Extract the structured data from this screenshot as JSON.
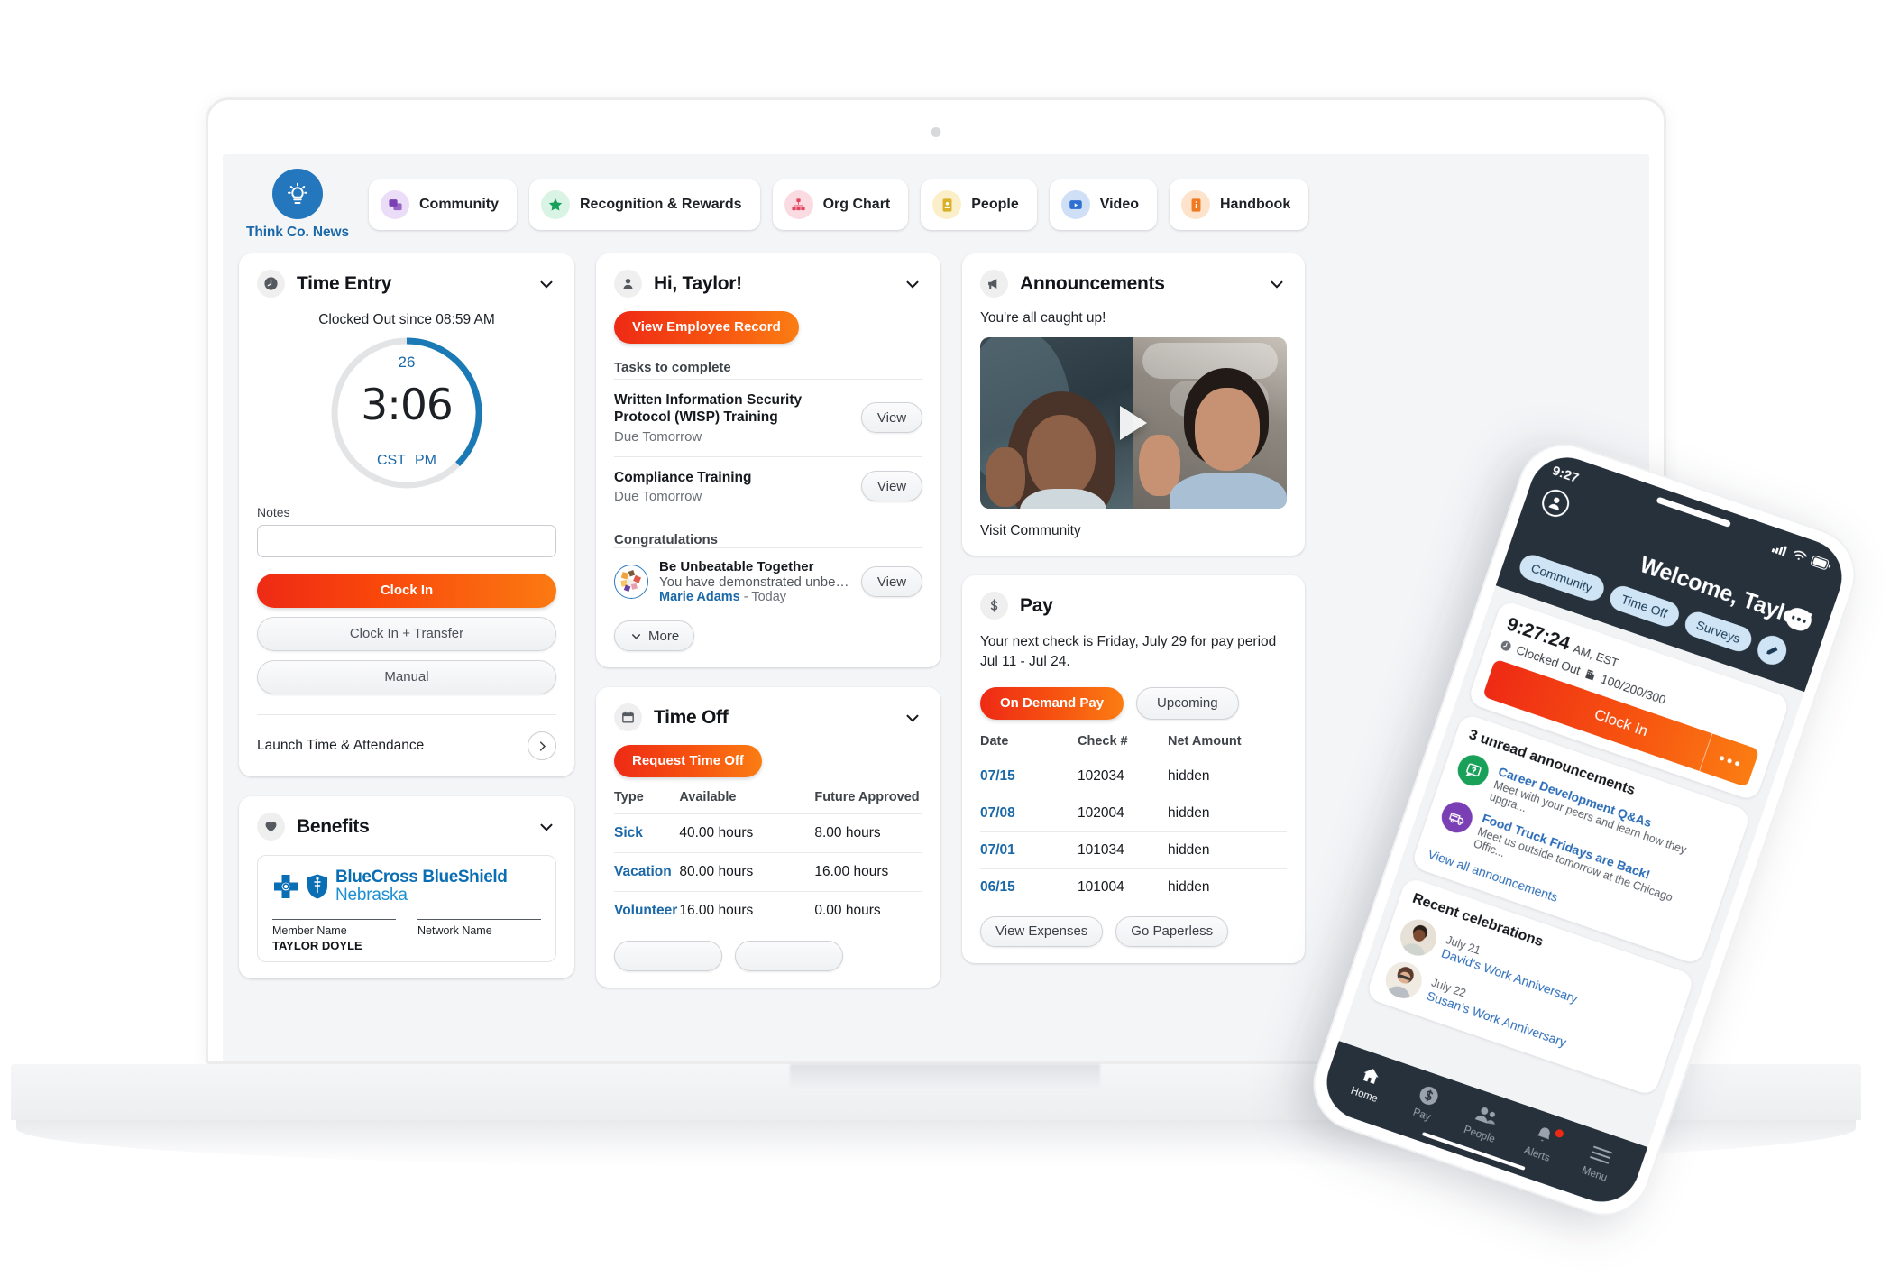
{
  "brand": {
    "label": "Think Co. News",
    "icon": "lightbulb-icon",
    "color": "#2477bd"
  },
  "topnav": {
    "items": [
      {
        "label": "Community",
        "icon": "chat-bubbles-icon",
        "bg": "#ebdcf7",
        "fg": "#7b3fb5"
      },
      {
        "label": "Recognition & Rewards",
        "icon": "star-icon",
        "bg": "#d9f3e4",
        "fg": "#17a05c"
      },
      {
        "label": "Org Chart",
        "icon": "org-chart-icon",
        "bg": "#fbdbe2",
        "fg": "#e3455f"
      },
      {
        "label": "People",
        "icon": "id-card-icon",
        "bg": "#fbefc9",
        "fg": "#d9b128"
      },
      {
        "label": "Video",
        "icon": "video-play-icon",
        "bg": "#cfdff6",
        "fg": "#2f6fd0"
      },
      {
        "label": "Handbook",
        "icon": "handbook-icon",
        "bg": "#fde2cc",
        "fg": "#f07a22"
      }
    ]
  },
  "time_entry": {
    "title": "Time Entry",
    "icon": "clock-icon",
    "status": "Clocked Out since 08:59 AM",
    "dial": {
      "day": "26",
      "time": "3:06",
      "timezone": "CST",
      "meridiem": "PM",
      "arc_percent": 45,
      "arc_color": "#1b7ab5",
      "track_color": "#e3e4e6"
    },
    "notes_label": "Notes",
    "notes_value": "",
    "notes_placeholder": "",
    "clock_in_label": "Clock In",
    "clock_in_transfer_label": "Clock In + Transfer",
    "manual_label": "Manual",
    "launch_label": "Launch Time & Attendance"
  },
  "benefits": {
    "title": "Benefits",
    "icon": "heart-icon",
    "carrier_line1_a": "BlueCross",
    "carrier_line1_b": "BlueShield",
    "carrier_line2": "Nebraska",
    "fields": [
      {
        "key": "Member Name",
        "value": "TAYLOR DOYLE"
      },
      {
        "key": "Network Name",
        "value": ""
      }
    ]
  },
  "greeting": {
    "title": "Hi, Taylor!",
    "icon": "person-icon",
    "cta_label": "View Employee Record",
    "tasks_label": "Tasks to complete",
    "tasks": [
      {
        "title": "Written Information Security Protocol (WISP) Training",
        "due": "Due Tomorrow",
        "action": "View"
      },
      {
        "title": "Compliance Training",
        "due": "Due Tomorrow",
        "action": "View"
      }
    ],
    "congrats_label": "Congratulations",
    "congrats": [
      {
        "title": "Be Unbeatable Together",
        "desc": "You have demonstrated unbeatable...",
        "author": "Marie Adams",
        "when": "- Today",
        "action": "View"
      }
    ],
    "more_label": "More"
  },
  "time_off": {
    "title": "Time Off",
    "icon": "calendar-icon",
    "request_label": "Request Time Off",
    "columns": [
      "Type",
      "Available",
      "Future Approved"
    ],
    "rows": [
      {
        "type": "Sick",
        "available": "40.00 hours",
        "future": "8.00 hours"
      },
      {
        "type": "Vacation",
        "available": "80.00 hours",
        "future": "16.00 hours"
      },
      {
        "type": "Volunteer",
        "available": "16.00 hours",
        "future": "0.00 hours"
      }
    ]
  },
  "announcements": {
    "title": "Announcements",
    "icon": "megaphone-icon",
    "status": "You're all caught up!",
    "media_alt": "two colleagues waving on a video call",
    "play_icon": "play-icon",
    "footer_link": "Visit Community"
  },
  "pay": {
    "title": "Pay",
    "icon": "dollar-icon",
    "summary": "Your next check is Friday, July 29 for pay period Jul 11 - Jul 24.",
    "on_demand_label": "On Demand Pay",
    "upcoming_label": "Upcoming",
    "columns": [
      "Date",
      "Check #",
      "Net Amount"
    ],
    "rows": [
      {
        "date": "07/15",
        "check": "102034",
        "net": "hidden"
      },
      {
        "date": "07/08",
        "check": "102004",
        "net": "hidden"
      },
      {
        "date": "07/01",
        "check": "101034",
        "net": "hidden"
      },
      {
        "date": "06/15",
        "check": "101004",
        "net": "hidden"
      }
    ],
    "view_expenses_label": "View Expenses",
    "go_paperless_label": "Go Paperless"
  },
  "phone": {
    "status_time": "9:27",
    "signal_icon": "cellular-signal-icon",
    "wifi_icon": "wifi-icon",
    "battery_icon": "battery-icon",
    "avatar_icon": "person-icon",
    "welcome": "Welcome, Taylor!",
    "chat_icon": "chat-icon",
    "pills": [
      "Community",
      "Time Off",
      "Surveys"
    ],
    "pen_icon": "pencil-icon",
    "clock": {
      "time": "9:27:24",
      "meridiem": "AM, EST",
      "status": "Clocked Out",
      "cost_center_icon": "building-icon",
      "cost_center": "100/200/300",
      "clock_in_label": "Clock In",
      "overflow_icon": "more-dots-icon"
    },
    "announcements": {
      "heading": "3 unread announcements",
      "items": [
        {
          "title": "Career Development Q&As",
          "desc": "Meet with your peers and learn how they upgra...",
          "icon": "question-chat-icon",
          "color": "#19a15a"
        },
        {
          "title": "Food Truck Fridays are Back!",
          "desc": "Meet us outside tomorrow at the Chicago Offic...",
          "icon": "food-truck-icon",
          "color": "#7b3fb5"
        }
      ],
      "link": "View all announcements"
    },
    "celebrations": {
      "heading": "Recent celebrations",
      "items": [
        {
          "date": "July 21",
          "title": "David's Work Anniversary",
          "avatar": "avatar-david"
        },
        {
          "date": "July 22",
          "title": "Susan's Work Anniversary",
          "avatar": "avatar-susan"
        }
      ]
    },
    "tabs": [
      {
        "label": "Home",
        "icon": "home-icon",
        "active": true
      },
      {
        "label": "Pay",
        "icon": "dollar-coin-icon",
        "active": false
      },
      {
        "label": "People",
        "icon": "people-icon",
        "active": false
      },
      {
        "label": "Alerts",
        "icon": "bell-icon",
        "active": false,
        "badge": true
      },
      {
        "label": "Menu",
        "icon": "hamburger-icon",
        "active": false
      }
    ]
  }
}
